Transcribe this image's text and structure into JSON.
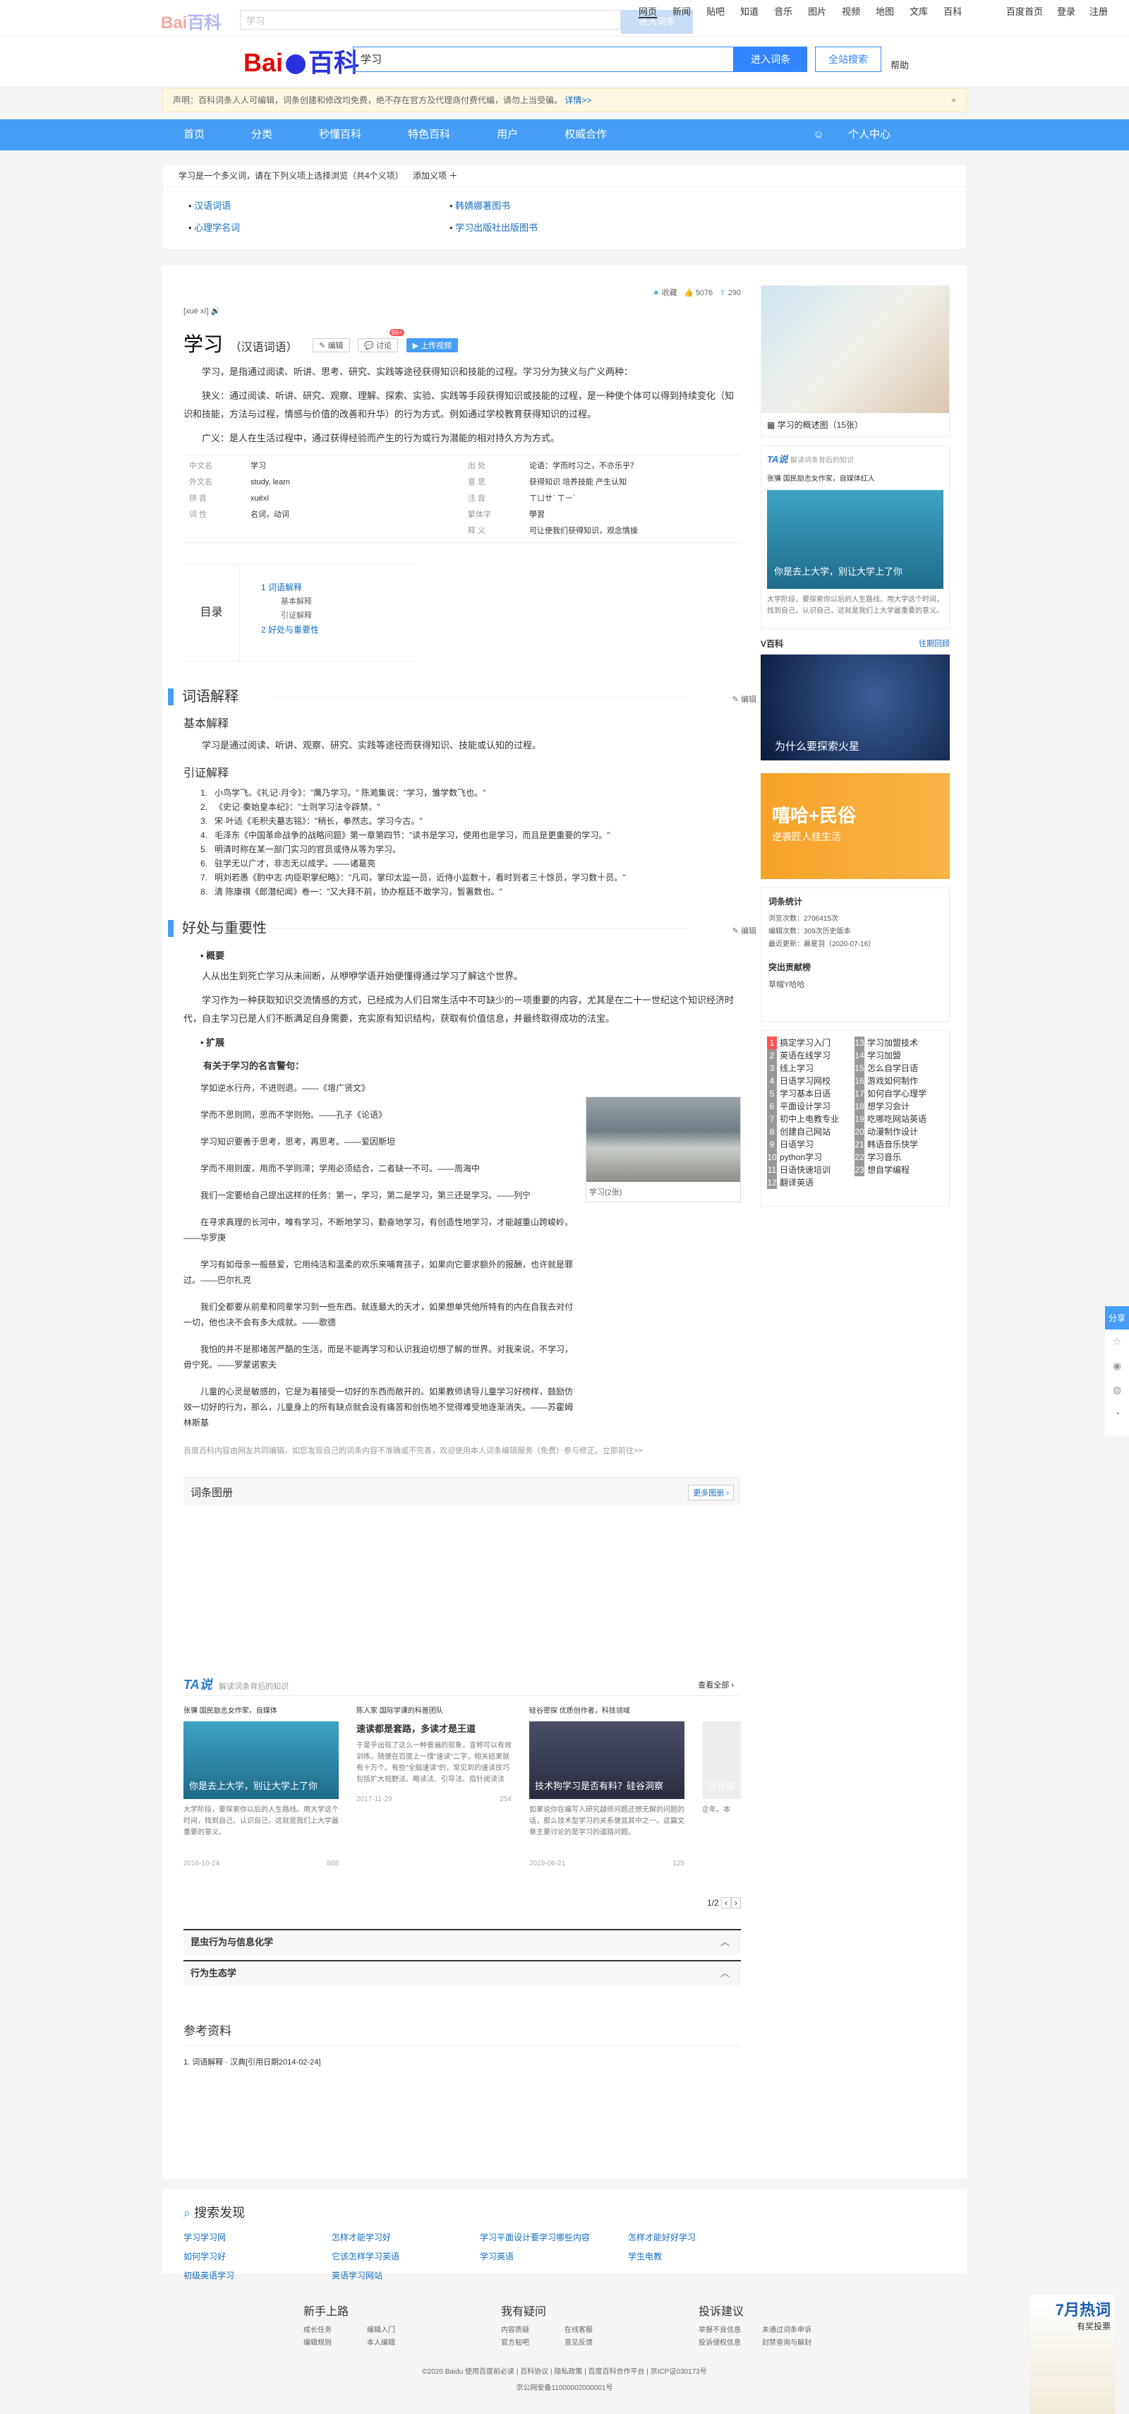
{
  "topbar": {
    "logo_a": "Bai",
    "logo_b": "百科",
    "placeholder": "学习",
    "btn": "进入词条",
    "nav": [
      "网页",
      "新闻",
      "贴吧",
      "知道",
      "音乐",
      "图片",
      "视频",
      "地图",
      "文库",
      "百科"
    ],
    "right": [
      "百度首页",
      "登录",
      "注册"
    ]
  },
  "header": {
    "logo_a": "Bai",
    "logo_b": "百科",
    "query": "学习",
    "btn1": "进入词条",
    "btn2": "全站搜索",
    "help": "帮助"
  },
  "notice": {
    "text": "声明：百科词条人人可编辑，词条创建和修改均免费，绝不存在官方及代理商付费代编，请勿上当受骗。",
    "link": "详情>>",
    "close": "×"
  },
  "navbar": {
    "items": [
      "首页",
      "分类",
      "秒懂百科",
      "特色百科",
      "用户",
      "权威合作"
    ],
    "user": "个人中心"
  },
  "poly": {
    "top": "学习是一个多义词，请在下列义项上选择浏览（共4个义项）",
    "add": "添加义项 ＋",
    "items": [
      "汉语词语",
      "韩婧娜著图书",
      "心理学名词",
      "学习出版社出版图书"
    ]
  },
  "entry": {
    "pinyin": "[xué xí]",
    "title": "学习",
    "type": "（汉语词语）",
    "btn_edit": "编辑",
    "btn_disc": "讨论",
    "badge": "99+",
    "btn_upload": "上传视频",
    "collect": "收藏",
    "likes": "5076",
    "shares": "290",
    "p1": "学习，是指通过阅读、听讲、思考、研究、实践等途径获得知识和技能的过程。学习分为狭义与广义两种：",
    "p2": "狭义：通过阅读、听讲、研究、观察、理解、探索、实验、实践等手段获得知识或技能的过程，是一种使个体可以得到持续变化（知识和技能，方法与过程，情感与价值的改善和升华）的行为方式。例如通过学校教育获得知识的过程。",
    "p3": "广义：是人在生活过程中，通过获得经验而产生的行为或行为潜能的相对持久方为方式。",
    "basic": [
      {
        "k1": "中文名",
        "v1": "学习",
        "k2": "出 处",
        "v2": "论语：学而时习之，不亦乐乎？"
      },
      {
        "k1": "外文名",
        "v1": "study, learn",
        "k2": "意 思",
        "v2": "获得知识 培养技能 产生认知"
      },
      {
        "k1": "拼 音",
        "v1": "xuéxí",
        "k2": "注 音",
        "v2": "ㄒㄩㄝˊ ㄒㄧˊ"
      },
      {
        "k1": "词 性",
        "v1": "名词，动词",
        "k2": "繁体字",
        "v2": "學習"
      },
      {
        "k1": "",
        "v1": "",
        "k2": "释 义",
        "v2": "可让使我们获得知识，观念情操"
      }
    ],
    "toc": {
      "label": "目录",
      "items": [
        "1  词语解释",
        "基本解释",
        "引证解释",
        "2  好处与重要性"
      ]
    }
  },
  "sec1": {
    "title": "词语解释",
    "edit": "编辑",
    "h_basic": "基本解释",
    "basic": "学习是通过阅读、听讲、观察、研究、实践等途径而获得知识、技能或认知的过程。",
    "h_ref": "引证解释",
    "refs": [
      "小鸟学飞。《礼记·月令》：\"鹰乃学习。\" 陈澔集说：\"学习，雏学数飞也。\"",
      "《史记·秦始皇本纪》：\"士则学习法令辟禁。\"",
      "宋·叶适《毛积夫墓志铭》：\"稍长，拳然志。学习今古。\"",
      "毛泽东《中国革命战争的战略问题》第一章第四节：\"读书是学习，使用也是学习，而且是更重要的学习。\"",
      "明清时称在某一部门实习的官员或侍从等为学习。",
      "驻学无以广才，非志无以成学。——诸葛亮",
      "明刘若愚《酌中志·内臣职掌纪略》：\"凡司，掌印太监一员，近侍小监数十，看时到者三十馀员，学习数十员。\"",
      "清 陈康祺《郎潜纪闻》卷一：\"又大拜不前，协办枢廷不敢学习，暂署数也。\""
    ]
  },
  "sec2": {
    "title": "好处与重要性",
    "edit": "编辑",
    "h_sum": "概要",
    "p1": "人从出生到死亡学习从未间断，从咿咿学语开始便懂得通过学习了解这个世界。",
    "p2": "学习作为一种获取知识交流情感的方式，已经成为人们日常生活中不可缺少的一项重要的内容，尤其是在二十一世纪这个知识经济时代，自主学习已是人们不断满足自身需要，充实原有知识结构，获取有价值信息，并最终取得成功的法宝。",
    "h_ext": "扩展",
    "h_quotes": "有关于学习的名言警句：",
    "quotes": [
      "学如逆水行舟，不进则退。——《增广贤文》",
      "学而不思则罔，思而不学则殆。——孔子《论语》",
      "学习知识要善于思考，思考，再思考。——爱因斯坦",
      "学而不用则废，用而不学则滞；学用必须结合，二者缺一不可。——周海中",
      "我们一定要给自己提出这样的任务：第一，学习，第二是学习，第三还是学习。——列宁",
      "在寻求真理的长河中，唯有学习，不断地学习，勤奋地学习，有创造性地学习，才能越重山跨峻岭。——华罗庚",
      "学习有如母亲一般慈爱，它用纯洁和温柔的欢乐来哺育孩子，如果向它要求额外的报酬，也许就是罪过。——巴尔扎克",
      "我们全都要从前辈和同辈学习到一些东西。就连最大的天才，如果想单凭他所特有的内在自我去对付一切，他也决不会有多大成就。——歌德",
      "我怕的并不是那堵苦严酷的生活，而是不能再学习和认识我迫切想了解的世界。对我来说，不学习，毋宁死。——罗蒙诺索夫",
      "儿童的心灵是敏感的，它是为着接受一切好的东西而敞开的。如果教师诱导儿童学习好榜样，鼓励仿效一切好的行为，那么，儿童身上的所有缺点就会没有痛苦和创伤地不觉得难受地逐渐消失。——苏霍姆林斯基"
    ],
    "img_caption": "学习(2张)",
    "note": "百度百科内容由网友共同编辑，如您发现自己的词条内容不准确或不完善，欢迎使用本人词条编辑服务（免费）参与修正。立即前往>>"
  },
  "album": {
    "title": "词条图册",
    "more": "更多图册 ›"
  },
  "tashuo": {
    "logo": "TA说",
    "sub": "解读词条背后的知识",
    "more": "查看全部 ›",
    "cards": [
      {
        "author": "张骥 国民励志女作家，自媒体",
        "title": "你是去上大学，别让大学上了你",
        "desc": "大学阶段，要探索你以后的人生路线。用大学这个时间，找到自己，认识自己，这就是我们上大学最重要的意义。",
        "date": "2016-10-24",
        "likes": "868"
      },
      {
        "author": "陈人家 国际学课的科普团队",
        "title": "速读都是套路，多读才是王道",
        "desc": "于是乎出现了这么一种普遍的现象，宣称可以有效训练。随便在百度上一搜\"速读\"二字，相关结果就有十万个。有些\"全脑速读\"的，常见到的速读技巧包括扩大视野法、略读法、引导法、指针阅读法等。",
        "date": "2017-11-29",
        "likes": "254"
      },
      {
        "author": "硅谷密探 优质创作者，科技领域",
        "title": "技术狗学习是否有料？硅谷洞察",
        "desc": "如果说你在编写入研究越修问题还想无解的问题的话，那么技术型学习的关系便显其中之一。这篇文章主要讨论的是学习的道路问题。",
        "date": "2019-06-21",
        "likes": "125"
      },
      {
        "author": "",
        "title": "没有做",
        "desc": "企年。本",
        "date": "",
        "likes": ""
      }
    ],
    "page": "1/2"
  },
  "related": [
    {
      "title": "昆虫行为与信息化学"
    },
    {
      "title": "行为生态学"
    }
  ],
  "refs": {
    "title": "参考资料",
    "items": [
      "1. 词语解释 · 汉典[引用日期2014-02-24]"
    ]
  },
  "side": {
    "gallery": "学习的概述图（15张）",
    "ta_logo": "TA说",
    "ta_sub": "解读词条背后的知识",
    "ta_author": "张骥 国民励志女作家，自媒体红人",
    "ta_title": "你是去上大学，别让大学上了你",
    "ta_desc": "大学阶段，要探索你以后的人生路线。用大学这个时间，找到自己，认识自己，这就是我们上大学最重要的意义。",
    "vbaike": "V百科",
    "vbaike_more": "往期回顾",
    "v_title": "为什么要探索火星",
    "promo1": "嘻哈+民俗",
    "promo2": "逆袭匠人桂生活",
    "stats_title": "词条统计",
    "stats": [
      "浏览次数：2706415次",
      "编辑次数：309次历史版本",
      "最近更新：晨星羽（2020-07-16）"
    ],
    "contrib_title": "突出贡献榜",
    "contrib": "草帽Y哈哈",
    "rank": [
      "搞定学习入门",
      "英语在线学习",
      "线上学习",
      "日语学习网校",
      "学习基本日语",
      "平面设计学习",
      "初中上电教专业",
      "创建自己网站",
      "日语学习",
      "python学习",
      "日语快速培训",
      "翻译英语",
      "学习加盟技术",
      "学习加盟",
      "怎么自学日语",
      "游戏如何制作",
      "如何自学心理学",
      "想学习会计",
      "吃哪吃网站英语",
      "动漫制作设计",
      "韩语音乐快学",
      "学习音乐",
      "想自学编程"
    ]
  },
  "discover": {
    "title": "搜索发现",
    "items": [
      "学习学习网",
      "怎样才能学习好",
      "学习平面设计要学习哪些内容",
      "怎样才能好好学习",
      "如何学习好",
      "它该怎样学习英语",
      "学习英语",
      "学生电教",
      "初级英语学习",
      "英语学习网站"
    ]
  },
  "footer": {
    "cols": [
      {
        "title": "新手上路",
        "links": [
          "成长任务",
          "编辑入门",
          "编辑规则",
          "本人编辑"
        ]
      },
      {
        "title": "我有疑问",
        "links": [
          "内容质疑",
          "在线客服",
          "官方贴吧",
          "意见反馈"
        ]
      },
      {
        "title": "投诉建议",
        "links": [
          "举报不良信息",
          "未通过词条申诉",
          "投诉侵权信息",
          "封禁查询与解封"
        ]
      }
    ],
    "copyright": "©2020 Baidu 使用百度前必读 | 百科协议 | 隐私政策 | 百度百科合作平台 | 京ICP证030173号",
    "beian": "京公网安备11000002000001号",
    "hot": "7月热词",
    "hot_sub": "有奖投票"
  },
  "share": {
    "label": "分享"
  },
  "colors": {
    "accent": "#459df5",
    "link": "#136ec2",
    "brand": "#e10602"
  }
}
